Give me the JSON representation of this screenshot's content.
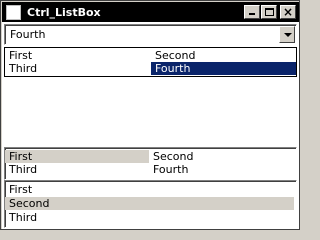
{
  "window": {
    "title": "Ctrl_ListBox",
    "minimize_icon": "minimize-icon",
    "maximize_icon": "maximize-icon",
    "close_icon": "close-icon",
    "close_glyph": "×"
  },
  "combo": {
    "value": "Fourth",
    "arrow_icon": "chevron-down-icon"
  },
  "dropdown": {
    "items": [
      "First",
      "Second",
      "Third",
      "Fourth"
    ],
    "selected": "Fourth"
  },
  "listbox2": {
    "items": [
      "First",
      "Second",
      "Third",
      "Fourth"
    ],
    "selected": "First"
  },
  "listbox3": {
    "items": [
      "First",
      "Second",
      "Third"
    ],
    "selected": "Second"
  },
  "colors": {
    "selection_active": "#0a246a",
    "selection_inactive": "#d4d0c8",
    "titlebar": "#000000",
    "face": "#d4d0c8"
  }
}
